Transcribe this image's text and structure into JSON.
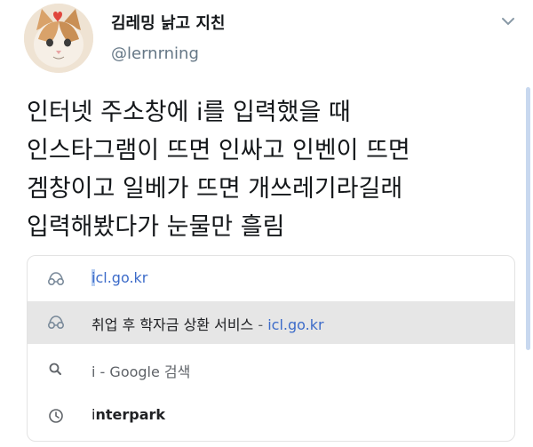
{
  "tweet": {
    "display_name": "김레밍 낡고 지친",
    "handle": "@lernrning",
    "lines": [
      "인터넷 주소창에 i를 입력했을 때",
      "인스타그램이 뜨면 인싸고 인벤이 뜨면",
      "겜창이고 일베가 뜨면 개쓰레기라길래",
      "입력해봤다가 눈물만 흘림"
    ]
  },
  "icons": {
    "avatar": "cat-avatar",
    "menu": "chevron-down-icon",
    "site": "globe-icon",
    "search": "search-icon",
    "history": "clock-icon"
  },
  "suggestions": {
    "row1": {
      "selected_prefix": "i",
      "rest": "cl.go.kr"
    },
    "row2": {
      "title": "취업 후 학자금 상환 서비스",
      "separator": "-",
      "url": "icl.go.kr"
    },
    "row3": {
      "query": "i",
      "separator": "-",
      "engine_action": "Google 검색"
    },
    "row4": {
      "prefix": "i",
      "rest": "nterpark"
    }
  },
  "colors": {
    "link": "#3c6bc9",
    "selection": "#b9cff2",
    "highlight_row": "#e6e6e6",
    "handle": "#657786"
  }
}
